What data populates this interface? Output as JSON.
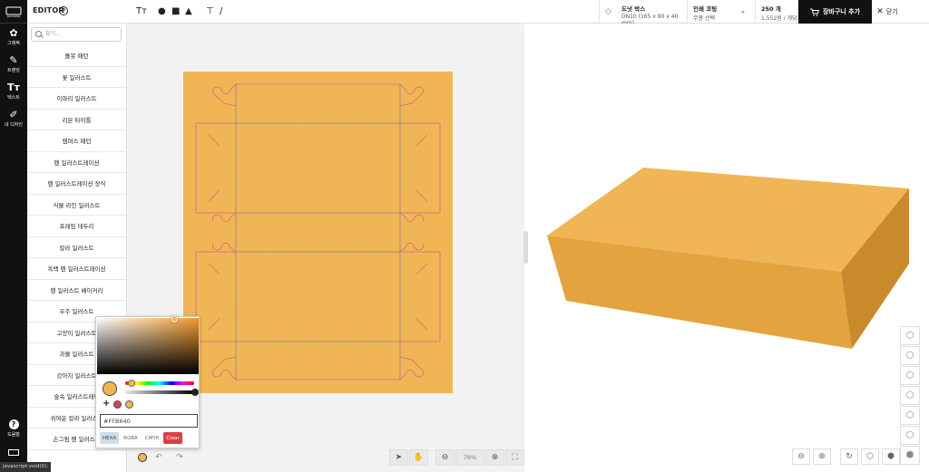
{
  "rail": {
    "items": [
      {
        "label": "그래픽",
        "icon": "graphic-icon"
      },
      {
        "label": "트렌딩",
        "icon": "trending-icon"
      },
      {
        "label": "텍스트",
        "icon": "text-icon"
      },
      {
        "label": "내 디자인",
        "icon": "my-design-icon"
      }
    ],
    "help_label": "도움말",
    "keyboard_label": "단축키"
  },
  "topbar": {
    "editor_title": "EDITOR",
    "help_glyph": "?",
    "text_tool_glyph": "Tт",
    "product": {
      "name": "도넛 박스",
      "size": "DN10 (165 x 90 x 40 mm)"
    },
    "coating": {
      "name": "인쇄 코팅",
      "value": "무광 선택"
    },
    "quantity": {
      "name": "250 개",
      "value": "1,552원 / 개당"
    },
    "cart_label": "장바구니 추가",
    "close_label": "닫기"
  },
  "panel": {
    "search_placeholder": "찾기...",
    "categories": [
      "돌봇 패턴",
      "꽃 일러스트",
      "이파리 일러스트",
      "리본 타이틀",
      "캠퍼스 패턴",
      "펜 일러스트레이션",
      "펜 일러스트레이션 장식",
      "식물 라인 일러스트",
      "프레임 테두리",
      "칼라 일러스트",
      "흑백 펜 일러스트레이션",
      "펜 일러스트 베이커리",
      "우주 일러스트",
      "고양이 일러스트",
      "과물 일러스트",
      "강아지 일러스트",
      "숲속 일러스트레이",
      "귀여운 칼라 일러스트",
      "손그림 펜 일러스트"
    ]
  },
  "canvas": {
    "sheet_color": "#f0b656",
    "zoom": "76%"
  },
  "picker": {
    "hex_value": "#FFB640",
    "modes": [
      "HEXA",
      "RGBA",
      "CMYK"
    ],
    "clear_label": "Clear",
    "saved_colors": [
      "#d9404a",
      "#f0b656"
    ]
  },
  "box3d": {
    "front": "#e3a33f",
    "top": "#f0b656",
    "side": "#c98a2c"
  },
  "status_tip": "javascript:void(0);"
}
